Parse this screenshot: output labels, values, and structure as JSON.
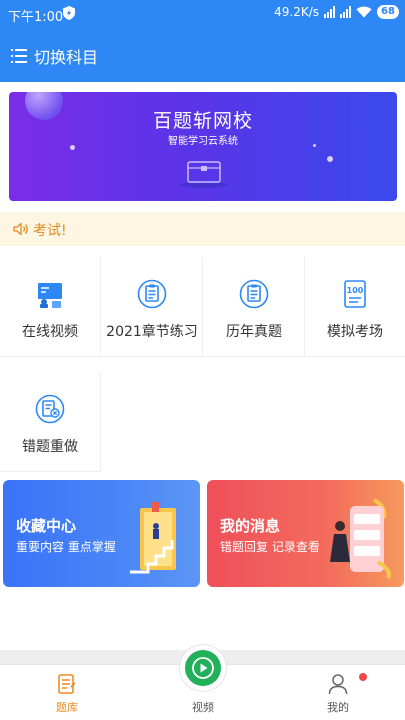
{
  "status_bar": {
    "time": "下午1:00",
    "network_speed": "49.2K/s",
    "battery": "68"
  },
  "header": {
    "title": "切换科目",
    "bg_color": "#2d88f6"
  },
  "banner": {
    "title": "百题斩网校",
    "subtitle": "智能学习云系统"
  },
  "notice": {
    "text": "考试!"
  },
  "grid": {
    "items": [
      {
        "label": "在线视频",
        "icon": "video-lecture-icon"
      },
      {
        "label": "2021章节练习",
        "icon": "chapter-practice-icon"
      },
      {
        "label": "历年真题",
        "icon": "past-exams-icon"
      },
      {
        "label": "模拟考场",
        "icon": "mock-exam-icon"
      },
      {
        "label": "错题重做",
        "icon": "wrong-questions-icon"
      }
    ]
  },
  "cards": [
    {
      "title": "收藏中心",
      "subtitle": "重要内容 重点掌握",
      "color": "#3a73f8"
    },
    {
      "title": "我的消息",
      "subtitle": "错题回复 记录查看",
      "color": "#ef4f5a"
    }
  ],
  "tabbar": {
    "items": [
      {
        "label": "题库",
        "active": true
      },
      {
        "label": "视频",
        "active": false
      },
      {
        "label": "我的",
        "active": false
      }
    ],
    "active_color": "#f08a24"
  }
}
